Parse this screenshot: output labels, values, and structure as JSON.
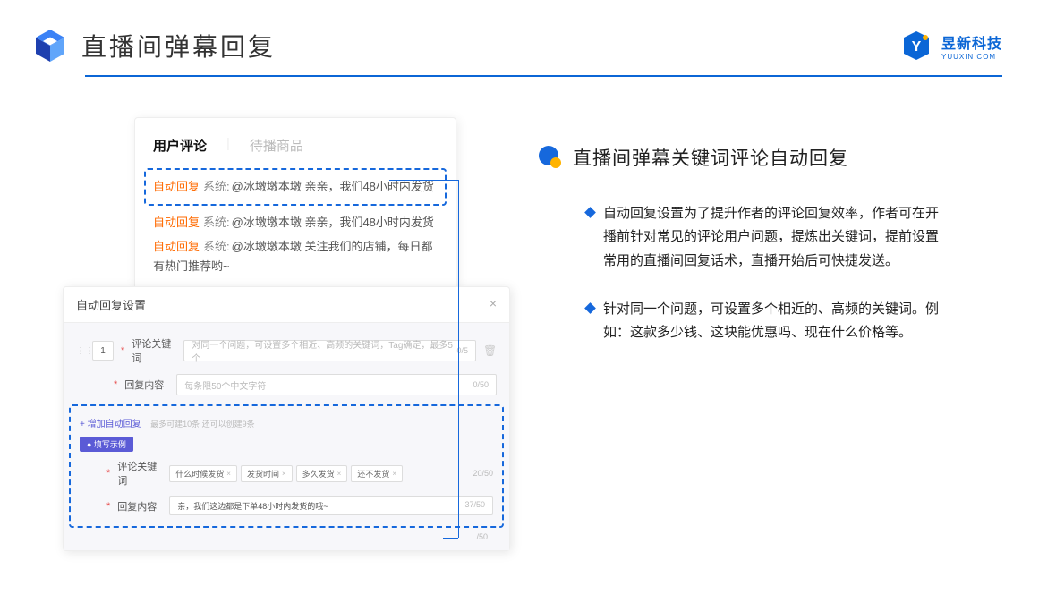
{
  "header": {
    "title": "直播间弹幕回复",
    "brand_name": "昱新科技",
    "brand_sub": "YUUXIN.COM"
  },
  "card1": {
    "tab_active": "用户评论",
    "tab_inactive": "待播商品",
    "auto_label": "自动回复",
    "sys_label": "系统:",
    "msg1": "@冰墩墩本墩 亲亲，我们48小时内发货",
    "msg2": "@冰墩墩本墩 亲亲，我们48小时内发货",
    "msg3_a": "@冰墩墩本墩 关注我们的店铺，每日都有热门推荐哟~"
  },
  "card2": {
    "title": "自动回复设置",
    "close": "×",
    "num": "1",
    "req": "*",
    "kw_label": "评论关键词",
    "kw_placeholder": "对同一个问题，可设置多个相近、高频的关键词，Tag确定，最多5个",
    "kw_count": "0/5",
    "reply_label": "回复内容",
    "reply_placeholder": "每条限50个中文字符",
    "reply_count": "0/50",
    "add_link": "+ 增加自动回复",
    "add_hint": "最多可建10条 还可以创建9条",
    "fill_badge": "● 填写示例",
    "ex_kw_label": "评论关键词",
    "tags": [
      "什么时候发货",
      "发货时间",
      "多久发货",
      "还不发货"
    ],
    "ex_kw_count": "20/50",
    "ex_reply_label": "回复内容",
    "ex_reply_text": "亲，我们这边都是下单48小时内发货的哦~",
    "ex_reply_count": "37/50",
    "bottom_count": "/50"
  },
  "right": {
    "section_title": "直播间弹幕关键词评论自动回复",
    "b1": "自动回复设置为了提升作者的评论回复效率，作者可在开播前针对常见的评论用户问题，提炼出关键词，提前设置常用的直播间回复话术，直播开始后可快捷发送。",
    "b2": "针对同一个问题，可设置多个相近的、高频的关键词。例如：这款多少钱、这块能优惠吗、现在什么价格等。"
  }
}
